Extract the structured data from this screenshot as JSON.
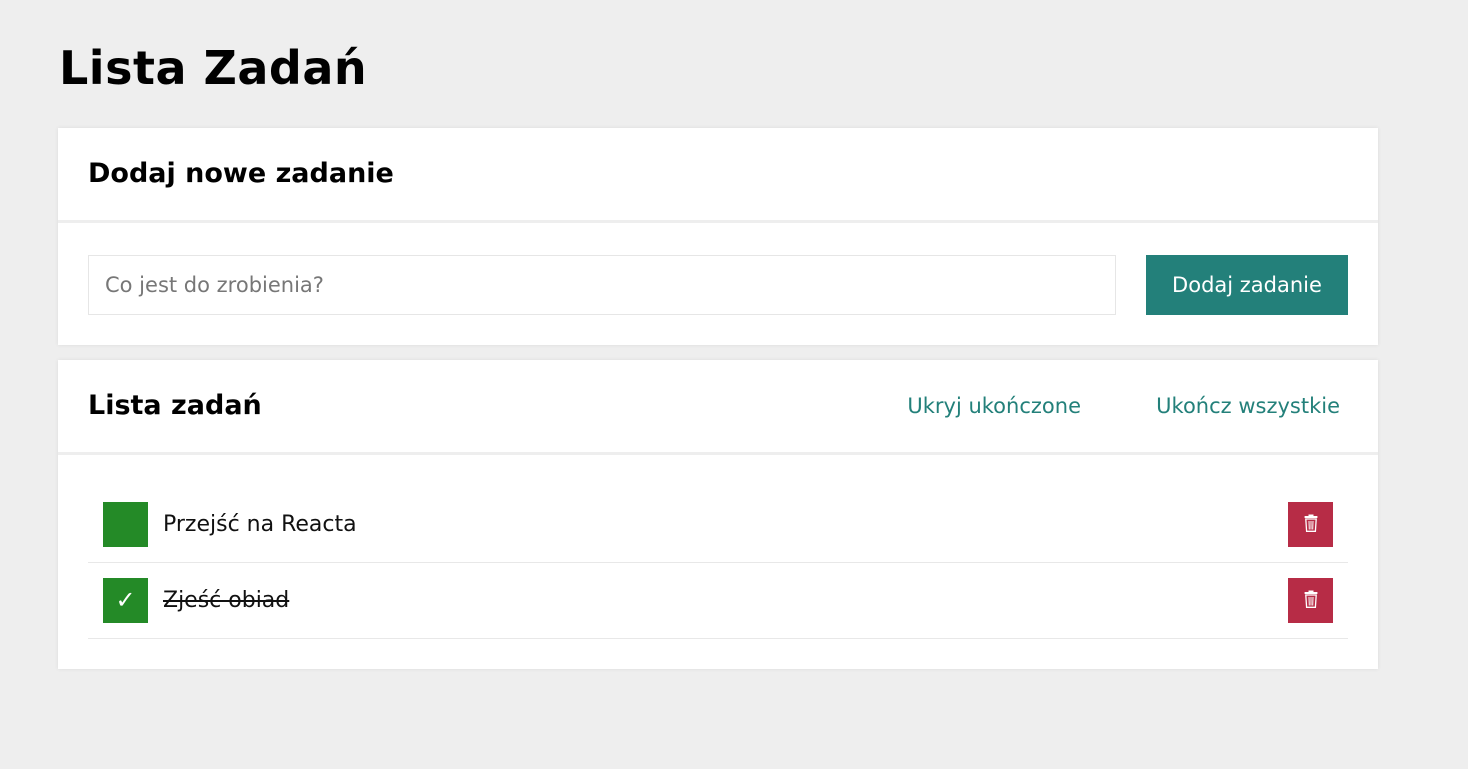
{
  "app": {
    "title": "Lista Zadań"
  },
  "add_section": {
    "heading": "Dodaj nowe zadanie",
    "input_value": "",
    "input_placeholder": "Co jest do zrobienia?",
    "button_label": "Dodaj zadanie"
  },
  "list_section": {
    "heading": "Lista zadań",
    "hide_done_label": "Ukryj ukończone",
    "complete_all_label": "Ukończ wszystkie",
    "tasks": [
      {
        "text": "Przejść na Reacta",
        "done": false,
        "toggle_glyph": ""
      },
      {
        "text": "Zjeść obiad",
        "done": true,
        "toggle_glyph": "✓"
      }
    ]
  },
  "icons": {
    "delete": "trash-icon",
    "done": "check-icon"
  },
  "colors": {
    "background": "#eeeeee",
    "card": "#ffffff",
    "accent_teal": "#23807a",
    "done_green": "#248a27",
    "delete_red": "#b72c46"
  }
}
